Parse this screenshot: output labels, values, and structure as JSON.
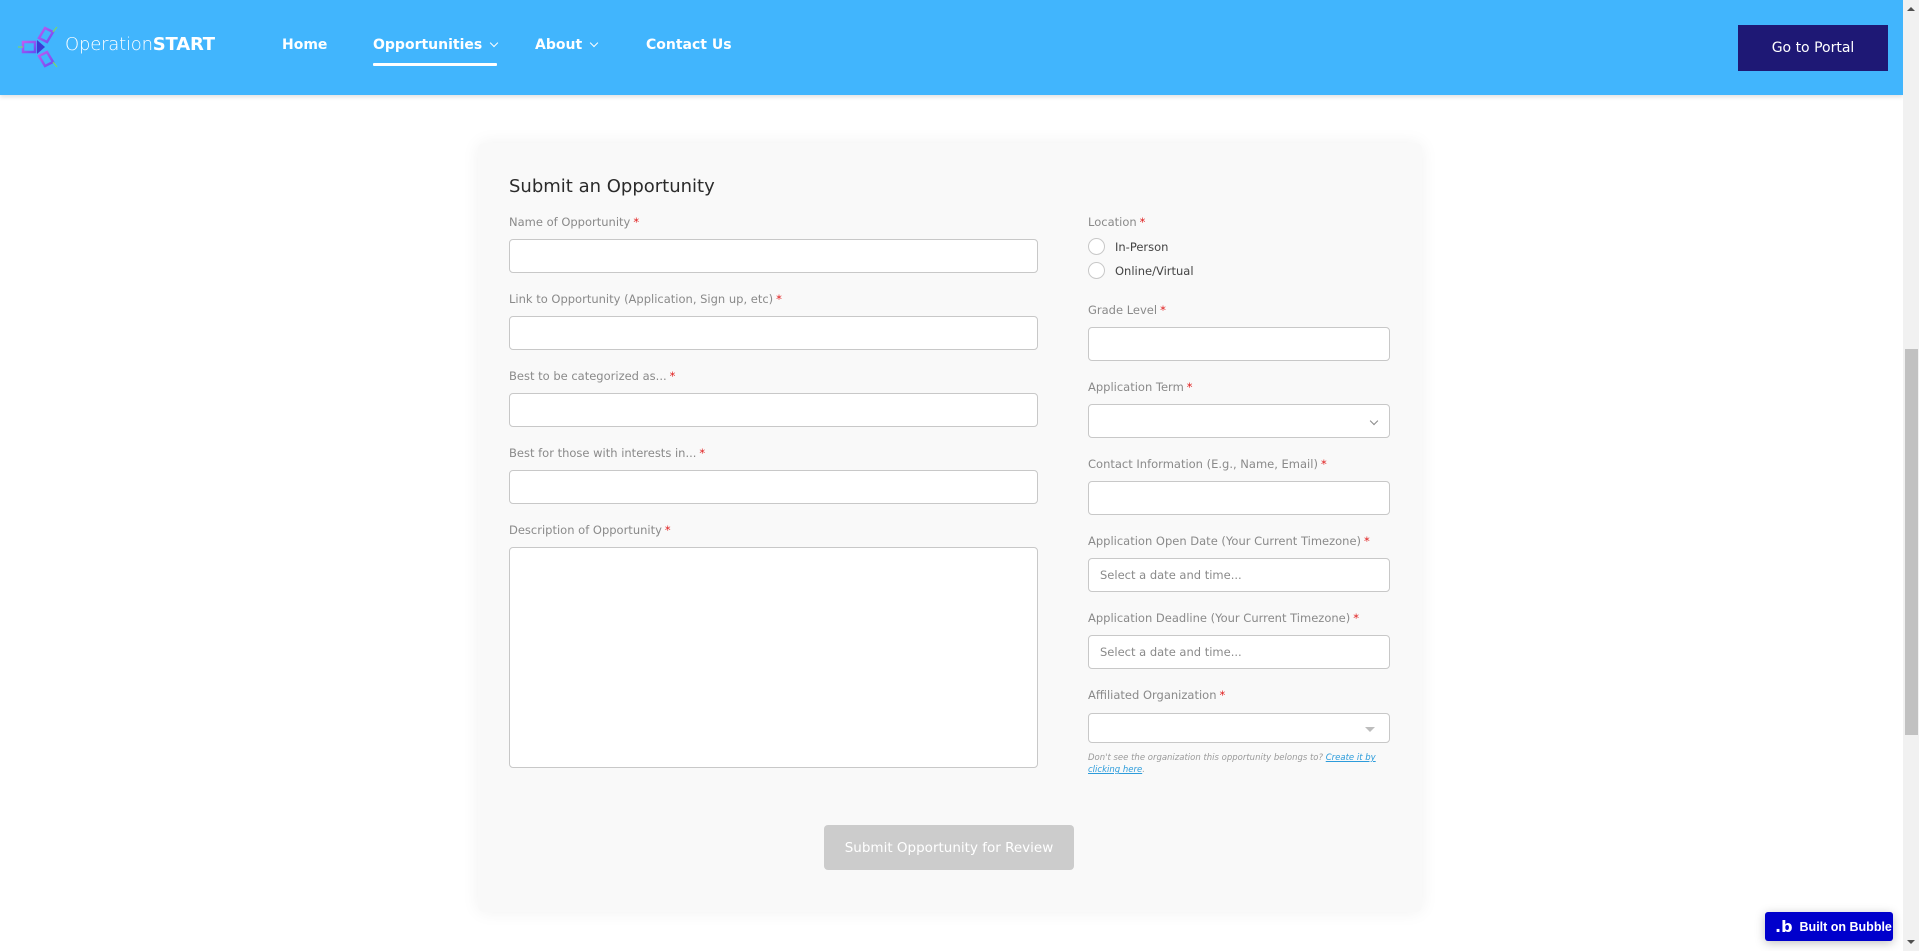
{
  "header": {
    "brand_light": "Operation",
    "brand_bold": "START",
    "logo_icon": "operationstart-logo-icon",
    "nav": [
      {
        "label": "Home",
        "has_dropdown": false,
        "active": false
      },
      {
        "label": "Opportunities",
        "has_dropdown": true,
        "active": true
      },
      {
        "label": "About",
        "has_dropdown": true,
        "active": false
      },
      {
        "label": "Contact Us",
        "has_dropdown": false,
        "active": false
      }
    ],
    "portal_button": "Go to Portal"
  },
  "form": {
    "title": "Submit an Opportunity",
    "required_marker": "*",
    "left": {
      "name": {
        "label": "Name of Opportunity",
        "value": ""
      },
      "link": {
        "label": "Link to Opportunity (Application, Sign up, etc)",
        "value": ""
      },
      "category": {
        "label": "Best to be categorized as...",
        "value": ""
      },
      "interests": {
        "label": "Best for those with interests in...",
        "value": ""
      },
      "description": {
        "label": "Description of Opportunity",
        "value": ""
      }
    },
    "right": {
      "location": {
        "label": "Location",
        "options": [
          "In-Person",
          "Online/Virtual"
        ],
        "selected": null
      },
      "grade_level": {
        "label": "Grade Level",
        "value": ""
      },
      "application_term": {
        "label": "Application Term",
        "selected": ""
      },
      "contact": {
        "label": "Contact Information (E.g., Name, Email)",
        "value": ""
      },
      "open_date": {
        "label": "Application Open Date (Your Current Timezone)",
        "placeholder": "Select a date and time..."
      },
      "deadline": {
        "label": "Application Deadline (Your Current Timezone)",
        "placeholder": "Select a date and time..."
      },
      "organization": {
        "label": "Affiliated Organization",
        "selected": ""
      },
      "helper_text": "Don't see the organization this opportunity belongs to? ",
      "helper_link": "Create it by clicking here",
      "helper_end": "."
    },
    "submit_button": "Submit Opportunity for Review"
  },
  "badge": {
    "logo": ".b",
    "label": "Built on Bubble"
  },
  "colors": {
    "header_bg": "#41B5FD",
    "portal_bg": "#1E1875",
    "required": "#E01B1B",
    "submit_disabled": "#CCCCCC",
    "bubble_bg": "#0000CC",
    "link": "#2D9CDB"
  }
}
